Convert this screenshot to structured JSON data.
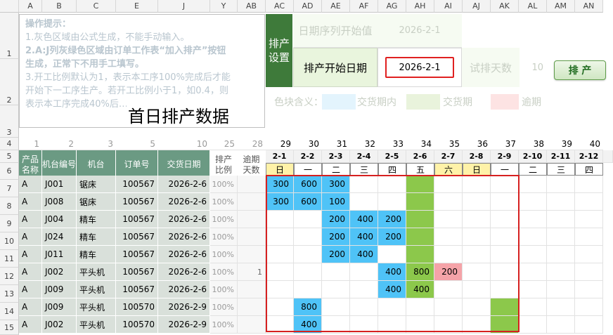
{
  "column_headers": [
    "A",
    "B",
    "C",
    "E",
    "J",
    "Y",
    "AB",
    "AC",
    "AD",
    "AE",
    "AF",
    "AG",
    "AH",
    "AI",
    "AJ",
    "AK",
    "AL",
    "AM",
    "AN"
  ],
  "row_headers": [
    "1",
    "2",
    "3",
    "4",
    "5",
    "6",
    "7",
    "8",
    "9",
    "10",
    "11",
    "12",
    "13",
    "14",
    "15"
  ],
  "notes": {
    "title": "操作提示：",
    "line1": "1.灰色区域由公式生成，不能手动输入。",
    "line2": "2.A:J列灰绿色区域由订单工作表“加入排产”按钮",
    "line3": "生成，正常下不用手工填写。",
    "line4": "3.开工比例默认为1，表示本工序100%完成后才能",
    "line5": "开始下一工序生产。若开工比例小于1，如0.4，则",
    "line6": "表示本工序完成40%后…"
  },
  "big_title": "首日排产数据",
  "settings": {
    "label": "排产设置",
    "seq_start_label": "日期序列开始值",
    "seq_start_value": "2026-2-1",
    "start_date_label": "排产开始日期",
    "start_date_value": "2026-2-1",
    "trial_days_label": "试排天数",
    "trial_days_value": "10",
    "run_button": "排 产"
  },
  "legend": {
    "label": "色块含义：",
    "in_period": "交货期内",
    "due": "交货期",
    "overdue": "逾期",
    "colors": {
      "in_period": "#e3f4fd",
      "due": "#e9f3dc",
      "overdue": "#fde3e3"
    }
  },
  "row4_numbers": [
    "1",
    "2",
    "3",
    "5",
    "10",
    "25",
    "28",
    "29",
    "30",
    "31",
    "32",
    "33",
    "34",
    "35",
    "36",
    "37",
    "38",
    "39",
    "40"
  ],
  "table_headers": {
    "product": "产品名称",
    "machine_no": "机台编号",
    "machine": "机台",
    "order_no": "订单号",
    "delivery": "交货日期",
    "ratio": "排产比例",
    "overdue_days": "逾期天数"
  },
  "dates": [
    "2-1",
    "2-2",
    "2-3",
    "2-4",
    "2-5",
    "2-6",
    "2-7",
    "2-8",
    "2-9",
    "2-10",
    "2-11",
    "2-12"
  ],
  "weekdays": [
    "日",
    "一",
    "二",
    "三",
    "四",
    "五",
    "六",
    "日",
    "一",
    "二",
    "三",
    "四"
  ],
  "rows": [
    {
      "row": "7",
      "product": "A",
      "machine_no": "J001",
      "machine": "锯床",
      "order": "100567",
      "delivery": "2026-2-6",
      "ratio": "100%",
      "overdue": "",
      "cells": [
        "300",
        "600",
        "300",
        "",
        "",
        "",
        "",
        "",
        "",
        "",
        "",
        ""
      ]
    },
    {
      "row": "8",
      "product": "A",
      "machine_no": "J008",
      "machine": "锯床",
      "order": "100567",
      "delivery": "2026-2-6",
      "ratio": "100%",
      "overdue": "",
      "cells": [
        "300",
        "600",
        "100",
        "",
        "",
        "",
        "",
        "",
        "",
        "",
        "",
        ""
      ]
    },
    {
      "row": "9",
      "product": "A",
      "machine_no": "J004",
      "machine": "精车",
      "order": "100567",
      "delivery": "2026-2-6",
      "ratio": "100%",
      "overdue": "",
      "cells": [
        "",
        "",
        "200",
        "400",
        "200",
        "",
        "",
        "",
        "",
        "",
        "",
        ""
      ]
    },
    {
      "row": "10",
      "product": "A",
      "machine_no": "J024",
      "machine": "精车",
      "order": "100567",
      "delivery": "2026-2-6",
      "ratio": "100%",
      "overdue": "",
      "cells": [
        "",
        "",
        "200",
        "400",
        "200",
        "",
        "",
        "",
        "",
        "",
        "",
        ""
      ]
    },
    {
      "row": "11",
      "product": "A",
      "machine_no": "J011",
      "machine": "精车",
      "order": "100567",
      "delivery": "2026-2-6",
      "ratio": "100%",
      "overdue": "",
      "cells": [
        "",
        "",
        "200",
        "400",
        "",
        "",
        "",
        "",
        "",
        "",
        "",
        ""
      ]
    },
    {
      "row": "12",
      "product": "A",
      "machine_no": "J002",
      "machine": "平头机",
      "order": "100567",
      "delivery": "2026-2-6",
      "ratio": "100%",
      "overdue": "1",
      "cells": [
        "",
        "",
        "",
        "",
        "400",
        "800",
        "200",
        "",
        "",
        "",
        "",
        ""
      ]
    },
    {
      "row": "13",
      "product": "A",
      "machine_no": "J009",
      "machine": "平头机",
      "order": "100567",
      "delivery": "2026-2-6",
      "ratio": "100%",
      "overdue": "",
      "cells": [
        "",
        "",
        "",
        "",
        "400",
        "400",
        "",
        "",
        "",
        "",
        "",
        ""
      ]
    },
    {
      "row": "14",
      "product": "A",
      "machine_no": "J009",
      "machine": "平头机",
      "order": "100570",
      "delivery": "2026-2-9",
      "ratio": "100%",
      "overdue": "",
      "cells": [
        "",
        "800",
        "",
        "",
        "",
        "",
        "",
        "",
        "",
        "",
        "",
        ""
      ]
    },
    {
      "row": "15",
      "product": "A",
      "machine_no": "J002",
      "machine": "平头机",
      "order": "100570",
      "delivery": "2026-2-9",
      "ratio": "100%",
      "overdue": "",
      "cells": [
        "",
        "400",
        "",
        "",
        "",
        "",
        "",
        "",
        "",
        "",
        "",
        ""
      ]
    }
  ],
  "fills": [
    [
      "blue",
      "blue",
      "blue",
      "",
      "",
      "green",
      "",
      "",
      "",
      "",
      "",
      ""
    ],
    [
      "blue",
      "blue",
      "blue",
      "",
      "",
      "green",
      "",
      "",
      "",
      "",
      "",
      ""
    ],
    [
      "",
      "",
      "blue",
      "blue",
      "blue",
      "green",
      "",
      "",
      "",
      "",
      "",
      ""
    ],
    [
      "",
      "",
      "blue",
      "blue",
      "blue",
      "green",
      "",
      "",
      "",
      "",
      "",
      ""
    ],
    [
      "",
      "",
      "blue",
      "blue",
      "",
      "green",
      "",
      "",
      "",
      "",
      "",
      ""
    ],
    [
      "",
      "",
      "",
      "",
      "blue",
      "green",
      "pink",
      "",
      "",
      "",
      "",
      ""
    ],
    [
      "",
      "",
      "",
      "",
      "blue",
      "green",
      "",
      "",
      "",
      "",
      "",
      ""
    ],
    [
      "",
      "blue",
      "",
      "",
      "",
      "",
      "",
      "",
      "green",
      "",
      "",
      ""
    ],
    [
      "",
      "blue",
      "",
      "",
      "",
      "",
      "",
      "",
      "green",
      "",
      "",
      ""
    ]
  ]
}
